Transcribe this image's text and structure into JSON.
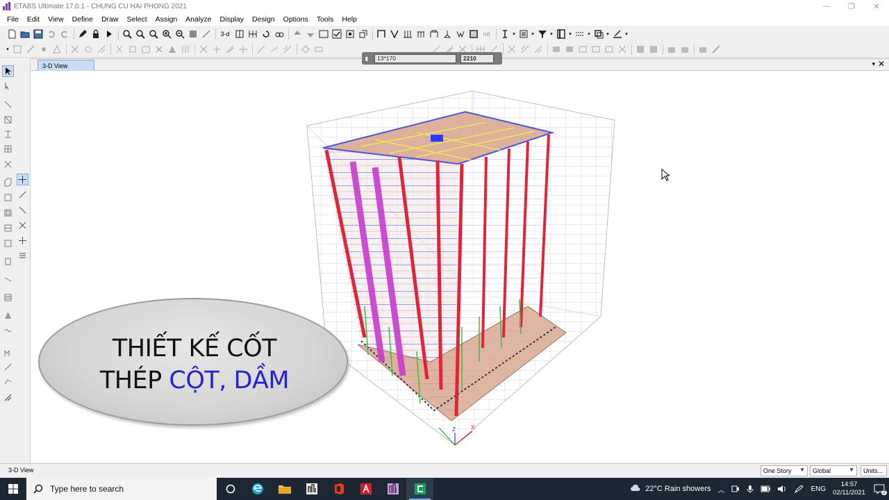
{
  "window": {
    "title": "ETABS Ultimate 17.0.1 - CHUNG CU HAI PHONG 2021",
    "controls": [
      "—",
      "❐",
      "✕"
    ]
  },
  "menu": [
    "File",
    "Edit",
    "View",
    "Define",
    "Draw",
    "Select",
    "Assign",
    "Analyze",
    "Display",
    "Design",
    "Options",
    "Tools",
    "Help"
  ],
  "toolbar": {
    "label_3d": "3-d",
    "label_plan": "Plan",
    "label_elev": "Elev",
    "label_nd": "nd"
  },
  "coord_box": {
    "left_value": "13*170",
    "right_value": "2210"
  },
  "view": {
    "tab_label": "3-D View",
    "dropdown_glyph": "▾",
    "close_glyph": "✕"
  },
  "overlay": {
    "line1": "THIẾT KẾ CỐT",
    "line2_plain": "THÉP ",
    "line2_highlight": "CỘT, DẦM"
  },
  "status": {
    "left": "3-D View",
    "story_select": "One Story",
    "coord_select": "Global",
    "units_button": "Units..."
  },
  "taskbar": {
    "search_placeholder": "Type here to search",
    "weather": "22°C  Rain showers",
    "language": "ENG",
    "time": "14:57",
    "date": "02/11/2021",
    "notification_count": "2"
  },
  "colors": {
    "accent_tab": "#c9dcf3",
    "taskbar_bg": "#1c2733",
    "overlay_highlight": "#2424c9"
  }
}
